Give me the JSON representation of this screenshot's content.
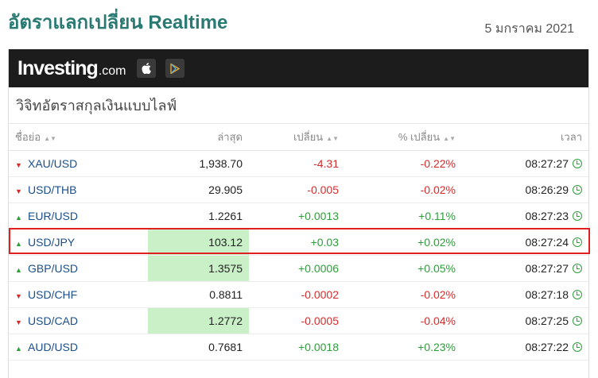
{
  "page": {
    "title": "อัตราแลกเปลี่ยน Realtime",
    "date": "5 มกราคม 2021"
  },
  "widget": {
    "brand": {
      "name": "Investing",
      "suffix": ".com"
    },
    "stores": [
      "apple-icon",
      "google-play-icon"
    ],
    "subtitle": "วิจิทอัตราสกุลเงินแบบไลฟ์",
    "headers": {
      "name": "ชื่อย่อ",
      "last": "ล่าสุด",
      "change": "เปลี่ยน",
      "pct": "% เปลี่ยน",
      "time": "เวลา"
    },
    "rows": [
      {
        "dir": "down",
        "pair": "XAU/USD",
        "last": "1,938.70",
        "change": "-4.31",
        "pct": "-0.22%",
        "time": "08:27:27",
        "flash": false
      },
      {
        "dir": "down",
        "pair": "USD/THB",
        "last": "29.905",
        "change": "-0.005",
        "pct": "-0.02%",
        "time": "08:26:29",
        "flash": false
      },
      {
        "dir": "up",
        "pair": "EUR/USD",
        "last": "1.2261",
        "change": "+0.0013",
        "pct": "+0.11%",
        "time": "08:27:23",
        "flash": false
      },
      {
        "dir": "up",
        "pair": "USD/JPY",
        "last": "103.12",
        "change": "+0.03",
        "pct": "+0.02%",
        "time": "08:27:24",
        "flash": true
      },
      {
        "dir": "up",
        "pair": "GBP/USD",
        "last": "1.3575",
        "change": "+0.0006",
        "pct": "+0.05%",
        "time": "08:27:27",
        "flash": true
      },
      {
        "dir": "down",
        "pair": "USD/CHF",
        "last": "0.8811",
        "change": "-0.0002",
        "pct": "-0.02%",
        "time": "08:27:18",
        "flash": false
      },
      {
        "dir": "down",
        "pair": "USD/CAD",
        "last": "1.2772",
        "change": "-0.0005",
        "pct": "-0.04%",
        "time": "08:27:25",
        "flash": true
      },
      {
        "dir": "up",
        "pair": "AUD/USD",
        "last": "0.7681",
        "change": "+0.0018",
        "pct": "+0.23%",
        "time": "08:27:22",
        "flash": false
      }
    ]
  },
  "colors": {
    "title": "#2a7a73",
    "negative": "#d72b2b",
    "positive": "#2e9e3a",
    "flash": "#c9f0c6",
    "highlight": "#e02020"
  }
}
